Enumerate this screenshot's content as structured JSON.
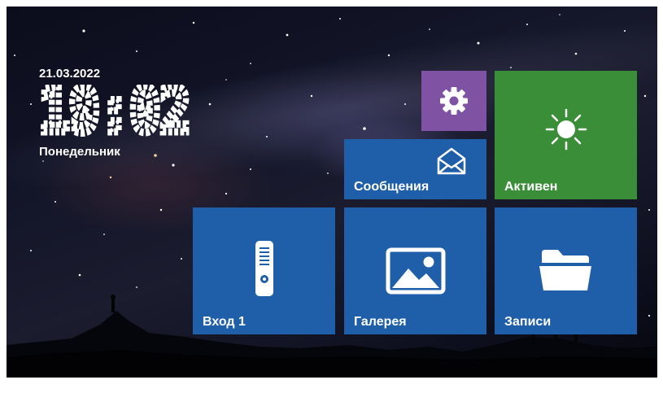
{
  "clock": {
    "date": "21.03.2022",
    "time": "19:02",
    "weekday": "Понедельник"
  },
  "tiles": {
    "settings": {
      "label": "",
      "icon": "gear-icon",
      "color": "#8052a3"
    },
    "messages": {
      "label": "Сообщения",
      "icon": "envelope-icon",
      "color": "#1f5faa"
    },
    "status": {
      "label": "Активен",
      "icon": "sun-icon",
      "color": "#3a8e37"
    },
    "entrance": {
      "label": "Вход 1",
      "icon": "door-panel-icon",
      "color": "#1f5faa"
    },
    "gallery": {
      "label": "Галерея",
      "icon": "image-icon",
      "color": "#1f5faa"
    },
    "records": {
      "label": "Записи",
      "icon": "folder-icon",
      "color": "#1f5faa"
    }
  }
}
